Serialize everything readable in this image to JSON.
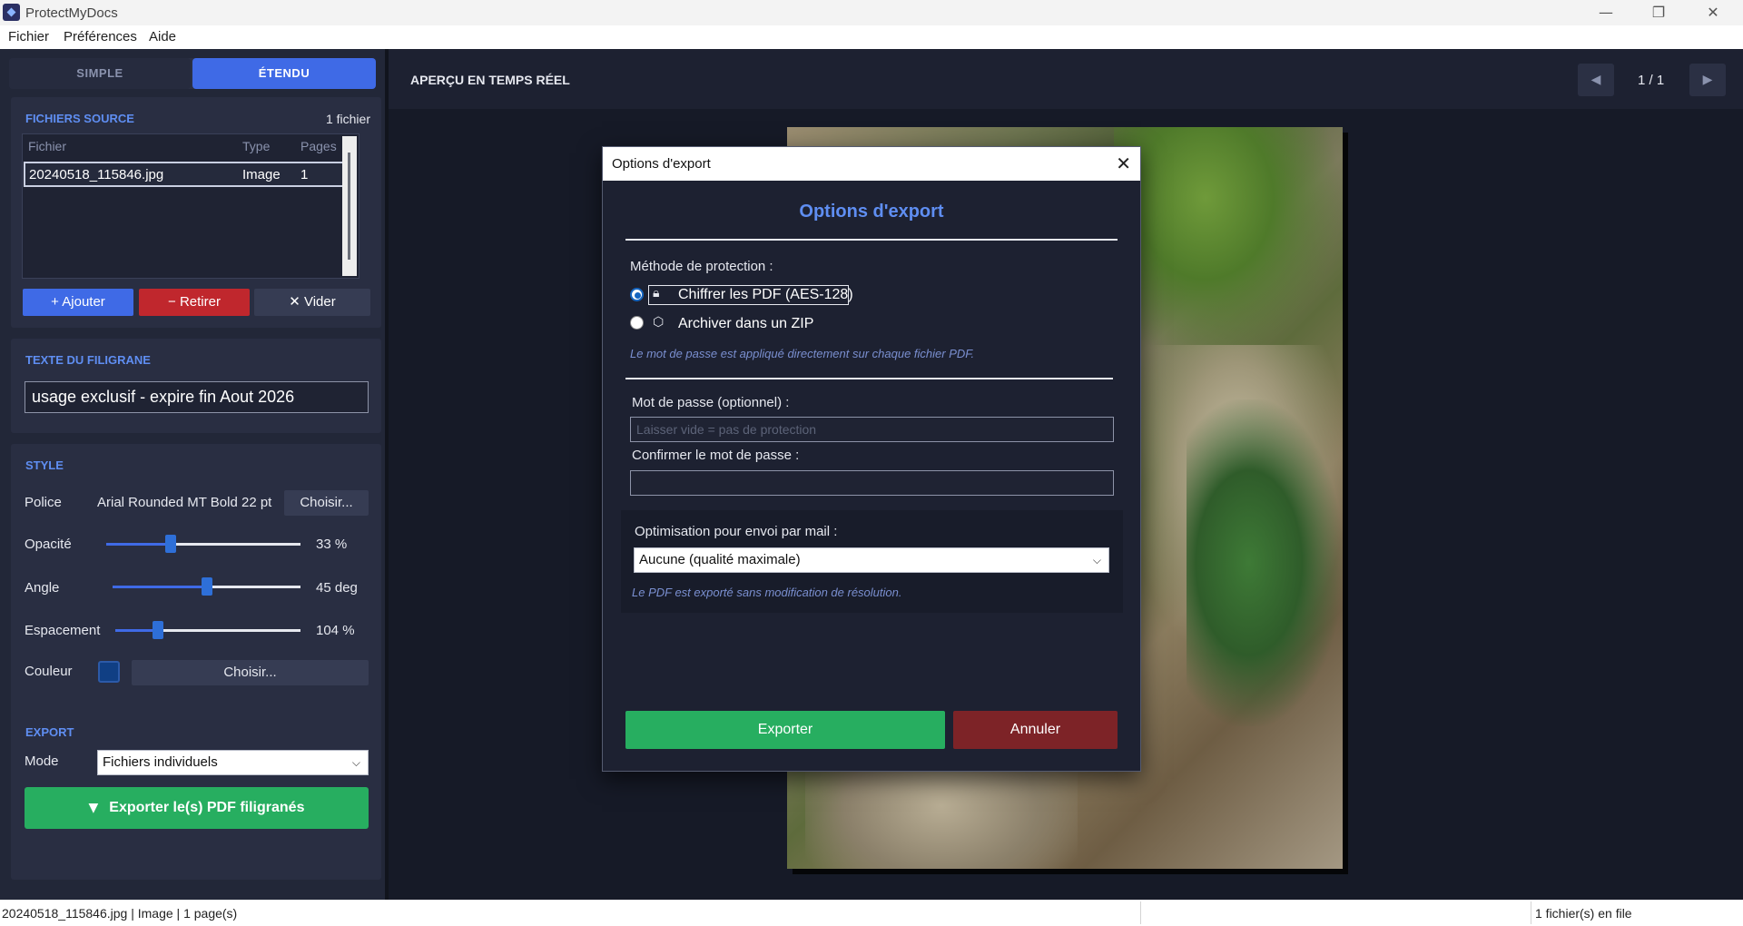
{
  "window": {
    "title": "ProtectMyDocs"
  },
  "menu": {
    "items": [
      "Fichier",
      "Préférences",
      "Aide"
    ]
  },
  "mode_tabs": {
    "simple": "SIMPLE",
    "etendu": "ÉTENDU",
    "active": "ÉTENDU"
  },
  "source": {
    "title": "FICHIERS SOURCE",
    "count": "1 fichier",
    "columns": [
      "Fichier",
      "Type",
      "Pages"
    ],
    "rows": [
      {
        "file": "20240518_115846.jpg",
        "type": "Image",
        "pages": "1"
      }
    ],
    "add_label": "+ Ajouter",
    "remove_label": "− Retirer",
    "clear_label": "✕ Vider"
  },
  "watermark": {
    "title": "TEXTE DU FILIGRANE",
    "text": "usage exclusif  - expire fin Aout 2026"
  },
  "style": {
    "title": "STYLE",
    "font_label": "Police",
    "font_value": "Arial Rounded MT Bold  22 pt",
    "font_choose": "Choisir...",
    "opacity_label": "Opacité",
    "opacity_value": "33 %",
    "opacity_fraction": 0.33,
    "angle_label": "Angle",
    "angle_value": "45 deg",
    "angle_fraction": 0.5,
    "spacing_label": "Espacement",
    "spacing_value": "104 %",
    "spacing_fraction": 0.23,
    "color_label": "Couleur",
    "color_hex": "#103f84",
    "color_choose": "Choisir..."
  },
  "export": {
    "title": "EXPORT",
    "mode_label": "Mode",
    "mode_value": "Fichiers individuels",
    "button": "Exporter le(s) PDF filigranés"
  },
  "preview": {
    "title": "APERÇU EN TEMPS RÉEL",
    "page_indicator": "1 / 1"
  },
  "dialog": {
    "window_title": "Options d'export",
    "heading": "Options d'export",
    "method_label": "Méthode de protection :",
    "option_encrypt": "Chiffrer les PDF (AES-128)",
    "option_zip": "Archiver dans un ZIP",
    "selected_option": "Chiffrer les PDF (AES-128)",
    "method_hint": "Le mot de passe est appliqué directement sur chaque fichier PDF.",
    "password_label": "Mot de passe (optionnel) :",
    "password_placeholder": "Laisser vide = pas de protection",
    "confirm_label": "Confirmer le mot de passe :",
    "confirm_value": "",
    "mail_label": "Optimisation pour envoi par mail :",
    "mail_value": "Aucune (qualité maximale)",
    "mail_hint": "Le PDF est exporté sans modification de résolution.",
    "export_button": "Exporter",
    "cancel_button": "Annuler"
  },
  "statusbar": {
    "left": "20240518_115846.jpg  |  Image  |  1 page(s)",
    "right": "1 fichier(s) en file"
  },
  "colors": {
    "accent": "#3f6ae6",
    "heading_blue": "#5f8ef2",
    "green": "#27ae60",
    "danger": "#c0272d",
    "cancel": "#7d2327"
  }
}
